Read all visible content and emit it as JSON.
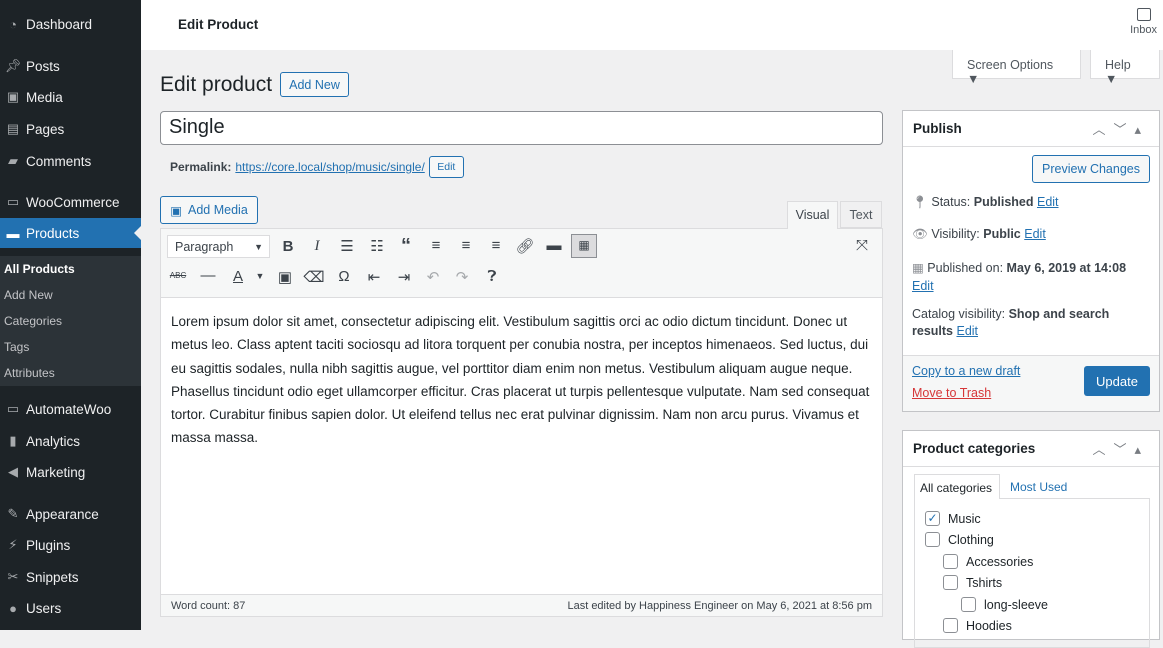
{
  "sidebar": {
    "items": [
      {
        "label": "Dashboard",
        "icon": "dashboard-icon"
      },
      {
        "label": "Posts",
        "icon": "pin-icon"
      },
      {
        "label": "Media",
        "icon": "media-icon"
      },
      {
        "label": "Pages",
        "icon": "pages-icon"
      },
      {
        "label": "Comments",
        "icon": "comment-icon"
      },
      {
        "label": "WooCommerce",
        "icon": "woo-icon"
      },
      {
        "label": "Products",
        "icon": "archive-icon"
      },
      {
        "label": "AutomateWoo",
        "icon": "aw-icon"
      },
      {
        "label": "Analytics",
        "icon": "bar-chart-icon"
      },
      {
        "label": "Marketing",
        "icon": "megaphone-icon"
      },
      {
        "label": "Appearance",
        "icon": "brush-icon"
      },
      {
        "label": "Plugins",
        "icon": "plug-icon"
      },
      {
        "label": "Snippets",
        "icon": "scissors-icon"
      },
      {
        "label": "Users",
        "icon": "user-icon"
      }
    ],
    "submenu": [
      "All Products",
      "Add New",
      "Categories",
      "Tags",
      "Attributes"
    ]
  },
  "topbar": {
    "title": "Edit Product",
    "inbox": "Inbox"
  },
  "screen_options": "Screen Options ▼",
  "help": "Help ▼",
  "page": {
    "heading": "Edit product",
    "add_new": "Add New",
    "title_value": "Single",
    "permalink_label": "Permalink:",
    "permalink_url": "https://core.local/shop/music/single/",
    "permalink_edit": "Edit"
  },
  "editor": {
    "add_media": "Add Media",
    "tab_visual": "Visual",
    "tab_text": "Text",
    "format": "Paragraph",
    "content": "Lorem ipsum dolor sit amet, consectetur adipiscing elit. Vestibulum sagittis orci ac odio dictum tincidunt. Donec ut metus leo. Class aptent taciti sociosqu ad litora torquent per conubia nostra, per inceptos himenaeos. Sed luctus, dui eu sagittis sodales, nulla nibh sagittis augue, vel porttitor diam enim non metus. Vestibulum aliquam augue neque. Phasellus tincidunt odio eget ullamcorper efficitur. Cras placerat ut turpis pellentesque vulputate. Nam sed consequat tortor. Curabitur finibus sapien dolor. Ut eleifend tellus nec erat pulvinar dignissim. Nam non arcu purus. Vivamus et massa massa.",
    "word_count": "Word count: 87",
    "last_edited": "Last edited by Happiness Engineer on May 6, 2021 at 8:56 pm"
  },
  "publish": {
    "title": "Publish",
    "preview": "Preview Changes",
    "status_label": "Status:",
    "status": "Published",
    "visibility_label": "Visibility:",
    "visibility": "Public",
    "published_label": "Published on:",
    "published": "May 6, 2019 at 14:08",
    "catalog_label": "Catalog visibility:",
    "catalog": "Shop and search results",
    "edit": "Edit",
    "copy": "Copy to a new draft",
    "trash": "Move to Trash",
    "update": "Update"
  },
  "categories": {
    "title": "Product categories",
    "tab_all": "All categories",
    "tab_used": "Most Used",
    "items": [
      {
        "label": "Music",
        "checked": true
      },
      {
        "label": "Clothing",
        "checked": false
      },
      {
        "label": "Accessories",
        "checked": false
      },
      {
        "label": "Tshirts",
        "checked": false
      },
      {
        "label": "long-sleeve",
        "checked": false
      },
      {
        "label": "Hoodies",
        "checked": false
      }
    ]
  }
}
